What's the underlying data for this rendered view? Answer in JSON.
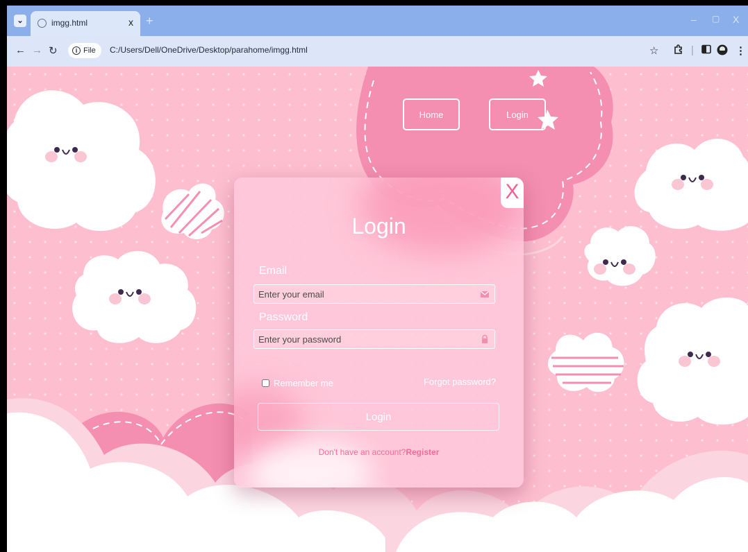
{
  "browser": {
    "tab_title": "imgg.html",
    "tab_close": "x",
    "new_tab": "+",
    "chip_label": "File",
    "url": "C:/Users/Dell/OneDrive/Desktop/parahome/imgg.html",
    "win_minimize": "–",
    "win_restore": "▢",
    "win_close": "X"
  },
  "nav": {
    "home_label": "Home",
    "login_label": "Login"
  },
  "modal": {
    "close_label": "X",
    "title": "Login",
    "email_label": "Email",
    "email_placeholder": "Enter your email",
    "email_value": "",
    "password_label": "Password",
    "password_placeholder": "Enter your password",
    "password_value": "",
    "remember_label": "Remember me",
    "forgot_label": "Forgot password?",
    "login_button": "Login",
    "no_account_text": "Don't have an account?",
    "register_label": "Register"
  },
  "icons": {
    "email_icon": "envelope-icon",
    "password_icon": "lock-icon"
  },
  "colors": {
    "page_background": "#fdbfd0",
    "accent_pink": "#f48fb1",
    "tabstrip": "#8aafea",
    "toolbar": "#dde6f8"
  }
}
